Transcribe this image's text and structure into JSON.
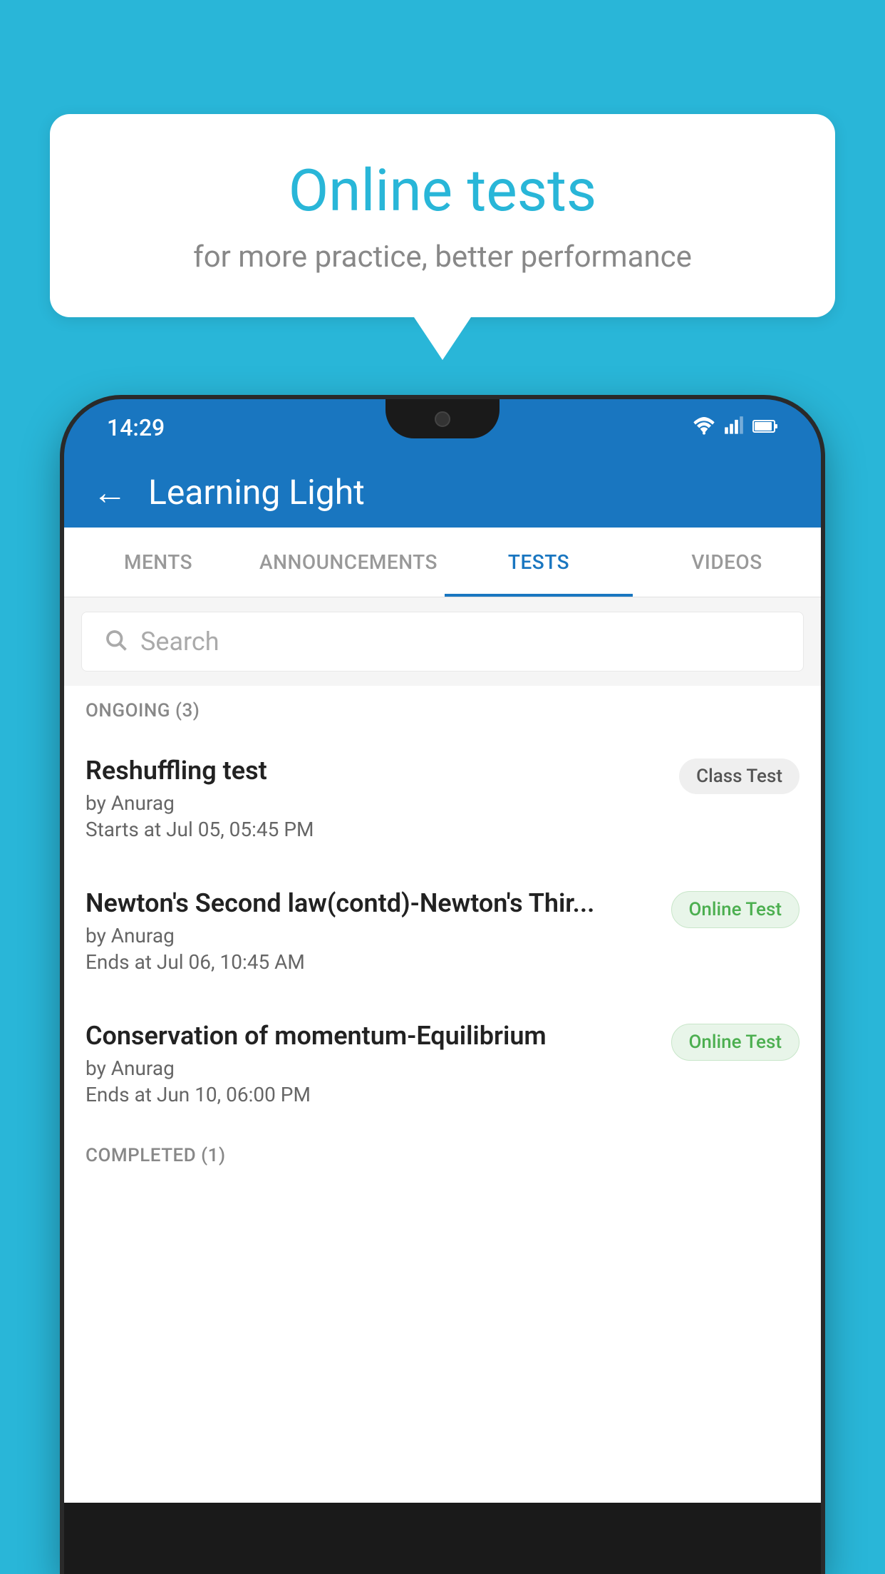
{
  "background_color": "#29b6d8",
  "speech_bubble": {
    "title": "Online tests",
    "subtitle": "for more practice, better performance"
  },
  "phone": {
    "status_bar": {
      "time": "14:29",
      "icons": [
        "wifi",
        "signal",
        "battery"
      ]
    },
    "header": {
      "back_label": "←",
      "title": "Learning Light"
    },
    "tabs": [
      {
        "label": "MENTS",
        "active": false
      },
      {
        "label": "ANNOUNCEMENTS",
        "active": false
      },
      {
        "label": "TESTS",
        "active": true
      },
      {
        "label": "VIDEOS",
        "active": false
      }
    ],
    "search": {
      "placeholder": "Search"
    },
    "sections": [
      {
        "header": "ONGOING (3)",
        "items": [
          {
            "name": "Reshuffling test",
            "author": "by Anurag",
            "date": "Starts at  Jul 05, 05:45 PM",
            "badge": "Class Test",
            "badge_type": "class"
          },
          {
            "name": "Newton's Second law(contd)-Newton's Thir...",
            "author": "by Anurag",
            "date": "Ends at  Jul 06, 10:45 AM",
            "badge": "Online Test",
            "badge_type": "online"
          },
          {
            "name": "Conservation of momentum-Equilibrium",
            "author": "by Anurag",
            "date": "Ends at  Jun 10, 06:00 PM",
            "badge": "Online Test",
            "badge_type": "online"
          }
        ]
      },
      {
        "header": "COMPLETED (1)",
        "items": []
      }
    ]
  }
}
